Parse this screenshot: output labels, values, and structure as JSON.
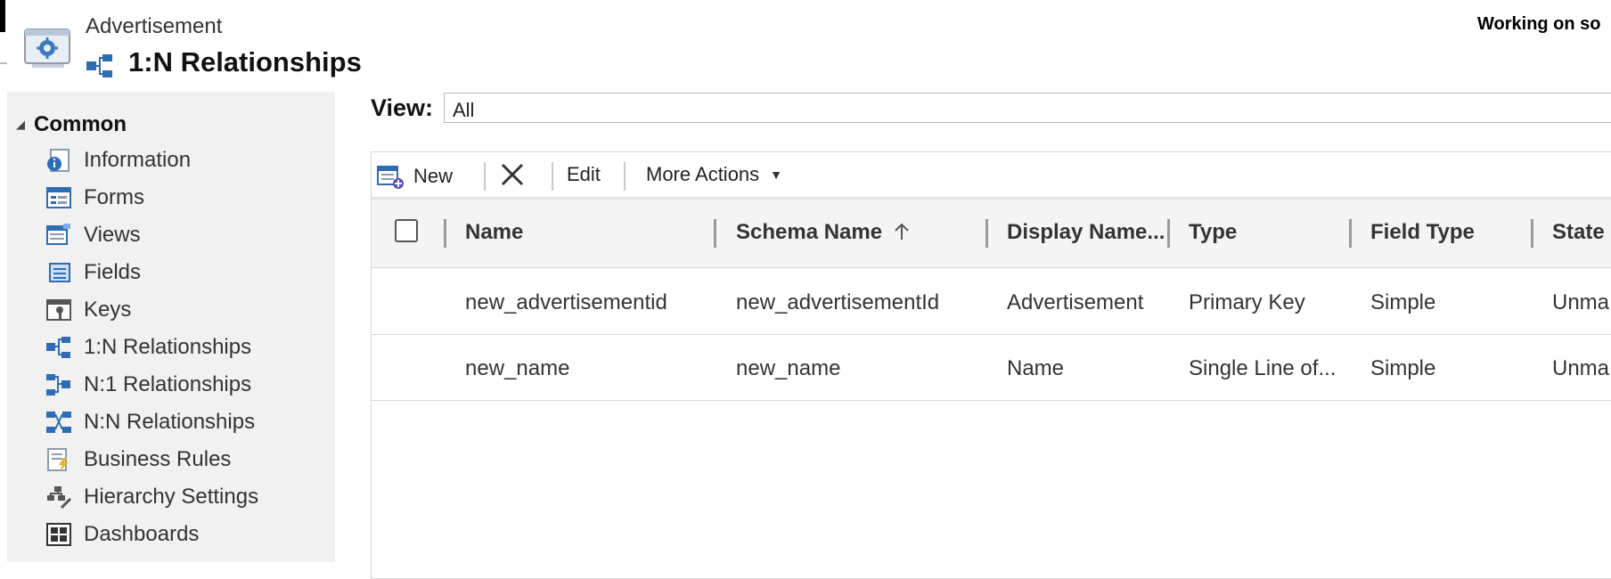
{
  "header": {
    "entity_name": "Advertisement",
    "page_title": "1:N Relationships",
    "status_text": "Working on so"
  },
  "sidebar": {
    "group_label": "Common",
    "items": [
      {
        "label": "Information",
        "icon": "information-icon"
      },
      {
        "label": "Forms",
        "icon": "forms-icon"
      },
      {
        "label": "Views",
        "icon": "views-icon"
      },
      {
        "label": "Fields",
        "icon": "fields-icon"
      },
      {
        "label": "Keys",
        "icon": "keys-icon"
      },
      {
        "label": "1:N Relationships",
        "icon": "one-to-many-icon"
      },
      {
        "label": "N:1 Relationships",
        "icon": "many-to-one-icon"
      },
      {
        "label": "N:N Relationships",
        "icon": "many-to-many-icon"
      },
      {
        "label": "Business Rules",
        "icon": "business-rules-icon"
      },
      {
        "label": "Hierarchy Settings",
        "icon": "hierarchy-icon"
      },
      {
        "label": "Dashboards",
        "icon": "dashboards-icon"
      }
    ]
  },
  "view": {
    "label": "View:",
    "selected": "All"
  },
  "toolbar": {
    "new_label": "New",
    "edit_label": "Edit",
    "more_actions_label": "More Actions"
  },
  "table": {
    "columns": [
      "Name",
      "Schema Name",
      "Display Name...",
      "Type",
      "Field Type",
      "State"
    ],
    "rows": [
      [
        "new_advertisementid",
        "new_advertisementId",
        "Advertisement",
        "Primary Key",
        "Simple",
        "Unma"
      ],
      [
        "new_name",
        "new_name",
        "Name",
        "Single Line of...",
        "Simple",
        "Unma"
      ]
    ]
  },
  "colors": {
    "sidebar_bg": "#f1f1f1",
    "header_bg": "#f4f4f4",
    "icon_blue": "#2e6db4"
  }
}
